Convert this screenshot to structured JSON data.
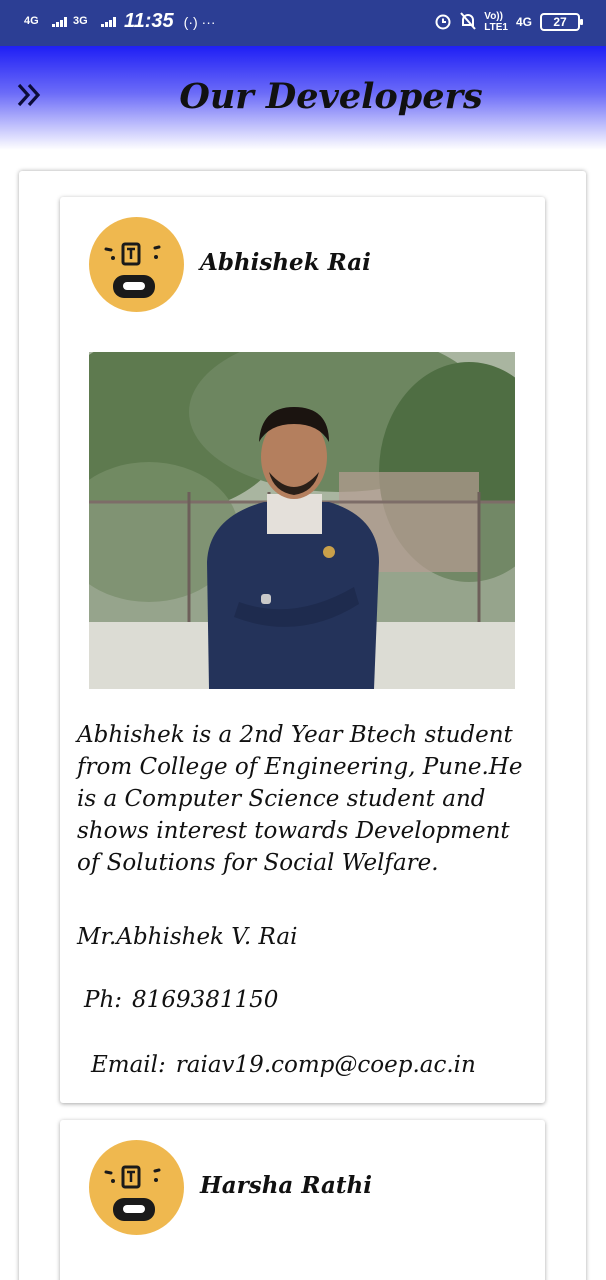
{
  "status_bar": {
    "net1": "4G",
    "net2": "3G",
    "time": "11:35",
    "extra": "(·) ···",
    "lte_top": "Vo))",
    "lte_bottom": "LTE1",
    "net3": "4G",
    "battery": "27"
  },
  "header": {
    "menu_icon": "double-chevron-right-icon",
    "title": "Our Developers",
    "gradient_top": "#1f1ff5",
    "gradient_bottom": "#ffffff"
  },
  "developers": [
    {
      "name": "Abhishek Rai",
      "bio": "Abhishek is a 2nd Year Btech student from College of Engineering, Pune.He is a Computer Science student and shows interest towards Development of Solutions for Social Welfare.",
      "full_name": "Mr.Abhishek V. Rai",
      "phone_label": "Ph:",
      "phone": "8169381150",
      "email_label": "Email:",
      "email": "raiav19.comp@coep.ac.in"
    },
    {
      "name": "Harsha Rathi"
    }
  ],
  "colors": {
    "status_bar": "#2c3e94",
    "avatar_bg": "#efb84f"
  }
}
